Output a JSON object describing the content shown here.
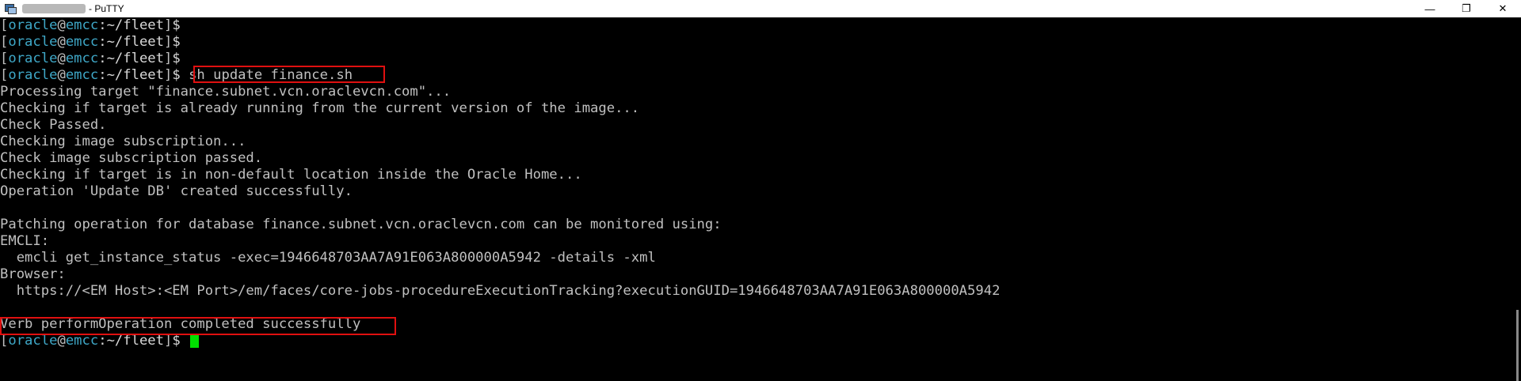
{
  "window": {
    "title": "- PuTTY",
    "controls": {
      "minimize": "—",
      "restore": "❐",
      "close": "✕"
    }
  },
  "prompt": {
    "open": "[",
    "user": "oracle",
    "at": "@",
    "host": "emcc",
    "path": ":~/fleet",
    "close": "]",
    "symbol": "$"
  },
  "terminal": {
    "command": " sh update_finance.sh",
    "output": [
      "Processing target \"finance.subnet.vcn.oraclevcn.com\"...",
      "Checking if target is already running from the current version of the image...",
      "Check Passed.",
      "Checking image subscription...",
      "Check image subscription passed.",
      "Checking if target is in non-default location inside the Oracle Home...",
      "Operation 'Update DB' created successfully.",
      "",
      "Patching operation for database finance.subnet.vcn.oraclevcn.com can be monitored using:",
      "EMCLI:",
      "  emcli get_instance_status -exec=1946648703AA7A91E063A800000A5942 -details -xml",
      "Browser:",
      "  https://<EM Host>:<EM Port>/em/faces/core-jobs-procedureExecutionTracking?executionGUID=1946648703AA7A91E063A800000A5942",
      ""
    ],
    "final_message": "Verb performOperation completed successfully"
  },
  "colors": {
    "highlight": "#e01010",
    "cursor": "#00e000",
    "prompt_user": "#3fa8c8",
    "text": "#c0c0c0"
  }
}
